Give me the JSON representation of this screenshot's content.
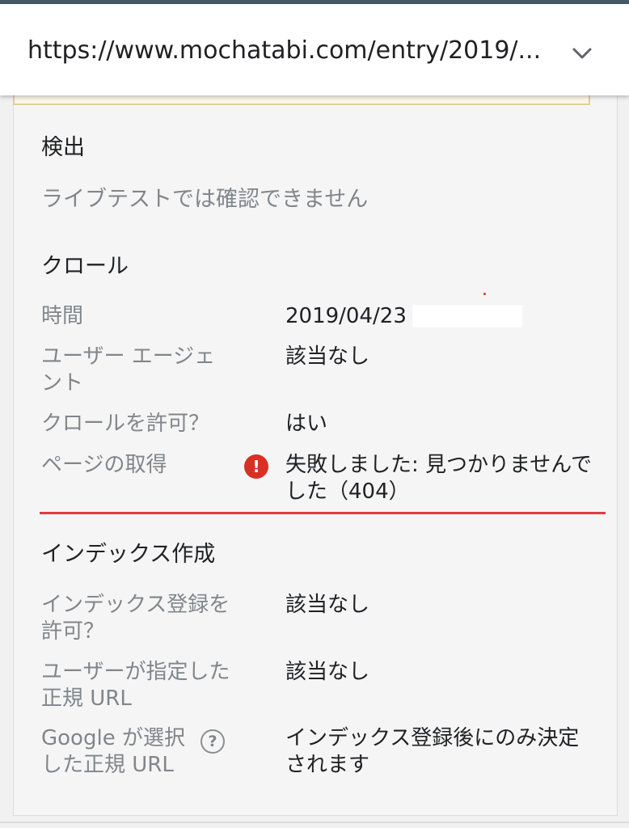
{
  "header": {
    "url": "https://www.mochatabi.com/entry/2019/..."
  },
  "discovery": {
    "title": "検出",
    "note": "ライブテストでは確認できません"
  },
  "crawl": {
    "title": "クロール",
    "rows": [
      {
        "label": "時間",
        "value": "2019/04/23"
      },
      {
        "label": "ユーザー エージェント",
        "value": "該当なし"
      },
      {
        "label": "クロールを許可？",
        "value": "はい"
      },
      {
        "label": "ページの取得",
        "value": "失敗しました: 見つかりませんでした（404）"
      }
    ]
  },
  "indexing": {
    "title": "インデックス作成",
    "rows": [
      {
        "label": "インデックス登録を許可？",
        "value": "該当なし"
      },
      {
        "label": "ユーザーが指定した正規 URL",
        "value": "該当なし"
      },
      {
        "label": "Google が選択した正規 URL",
        "value": "インデックス登録後にのみ決定されます"
      }
    ]
  },
  "icons": {
    "error": "!",
    "help": "?"
  },
  "colors": {
    "error": "#d93025",
    "header_strip": "#455a64",
    "secondary_text": "#80868b"
  }
}
